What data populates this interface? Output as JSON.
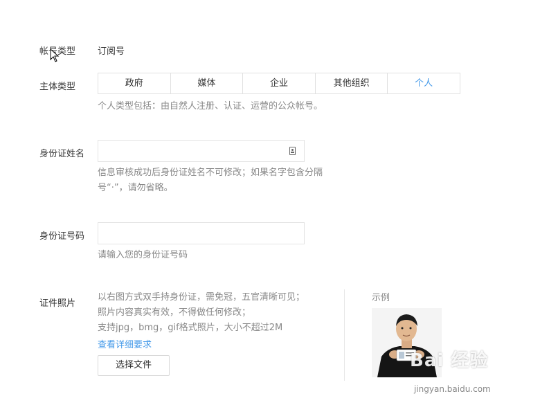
{
  "account_type": {
    "label": "帐号类型",
    "value": "订阅号"
  },
  "subject_type": {
    "label": "主体类型",
    "options": [
      "政府",
      "媒体",
      "企业",
      "其他组织",
      "个人"
    ],
    "selected": "个人",
    "hint": "个人类型包括：由自然人注册、认证、运营的公众帐号。"
  },
  "id_name": {
    "label": "身份证姓名",
    "value": "",
    "placeholder": "",
    "hint_line1": "信息审核成功后身份证姓名不可修改；如果名字包含分隔",
    "hint_line2": "号“·”，请勿省略。"
  },
  "id_number": {
    "label": "身份证号码",
    "value": "",
    "placeholder": "",
    "hint": "请输入您的身份证号码"
  },
  "id_photo": {
    "label": "证件照片",
    "desc_line1": "以右图方式双手持身份证，需免冠，五官清晰可见；",
    "desc_line2": "照片内容真实有效，不得做任何修改；",
    "desc_line3": "支持jpg，bmg，gif格式照片，大小不超过2M",
    "details_link": "查看详细要求",
    "choose_file_button": "选择文件",
    "example_label": "示例"
  },
  "watermark": {
    "text": "Bai 经验",
    "url": "jingyan.baidu.com"
  },
  "colors": {
    "accent": "#459ae9",
    "hint": "#888888",
    "border": "#e0e0e0"
  }
}
